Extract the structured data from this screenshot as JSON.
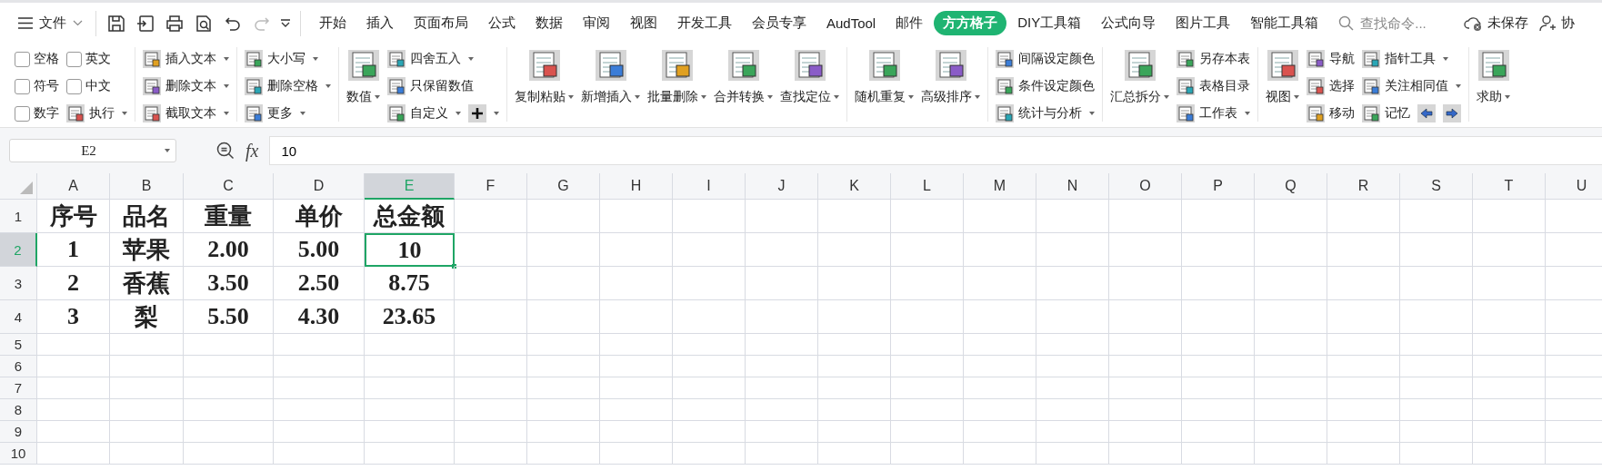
{
  "menu_bar": {
    "file_menu": "文件",
    "quick_access": [
      {
        "disabled": false
      },
      {
        "disabled": false
      },
      {
        "disabled": false
      },
      {
        "disabled": false
      },
      {
        "disabled": false
      },
      {
        "disabled": true
      }
    ],
    "tabs": [
      {
        "label": "开始",
        "selected": false
      },
      {
        "label": "插入",
        "selected": false
      },
      {
        "label": "页面布局",
        "selected": false
      },
      {
        "label": "公式",
        "selected": false
      },
      {
        "label": "数据",
        "selected": false
      },
      {
        "label": "审阅",
        "selected": false
      },
      {
        "label": "视图",
        "selected": false
      },
      {
        "label": "开发工具",
        "selected": false
      },
      {
        "label": "会员专享",
        "selected": false
      },
      {
        "label": "AudTool",
        "selected": false
      },
      {
        "label": "邮件",
        "selected": false
      },
      {
        "label": "方方格子",
        "selected": true
      },
      {
        "label": "DIY工具箱",
        "selected": false
      },
      {
        "label": "公式向导",
        "selected": false
      },
      {
        "label": "图片工具",
        "selected": false
      },
      {
        "label": "智能工具箱",
        "selected": false
      }
    ],
    "search": {
      "placeholder": "查找命令..."
    },
    "save_status": "未保存",
    "collaborate": "协"
  },
  "ribbon": [
    {
      "columns": [
        {
          "kind": "stack",
          "rows": [
            [
              {
                "kind": "checkbox",
                "label": "空格",
                "checked": false
              }
            ],
            [
              {
                "kind": "checkbox",
                "label": "符号",
                "checked": false
              }
            ],
            [
              {
                "kind": "checkbox",
                "label": "数字",
                "checked": false
              }
            ]
          ]
        },
        {
          "kind": "stack",
          "rows": [
            [
              {
                "kind": "checkbox",
                "label": "英文",
                "checked": false
              }
            ],
            [
              {
                "kind": "checkbox",
                "label": "中文",
                "checked": false
              }
            ],
            [
              {
                "kind": "button",
                "label": "执行",
                "dropdown": true
              }
            ]
          ]
        }
      ]
    },
    {
      "columns": [
        {
          "kind": "stack",
          "rows": [
            [
              {
                "kind": "button",
                "label": "插入文本",
                "dropdown": true
              }
            ],
            [
              {
                "kind": "button",
                "label": "删除文本",
                "dropdown": true
              }
            ],
            [
              {
                "kind": "button",
                "label": "截取文本",
                "dropdown": true
              }
            ]
          ]
        }
      ]
    },
    {
      "columns": [
        {
          "kind": "stack",
          "rows": [
            [
              {
                "kind": "button",
                "label": "大小写",
                "dropdown": true
              }
            ],
            [
              {
                "kind": "button",
                "label": "删除空格",
                "dropdown": true
              }
            ],
            [
              {
                "kind": "button",
                "label": "更多",
                "dropdown": true
              }
            ]
          ]
        }
      ]
    },
    {
      "columns": [
        {
          "kind": "large",
          "label": "数值",
          "dropdown": true
        },
        {
          "kind": "stack",
          "rows": [
            [
              {
                "kind": "button",
                "label": "四舍五入",
                "dropdown": true
              }
            ],
            [
              {
                "kind": "button",
                "label": "只保留数值",
                "dropdown": false
              }
            ],
            [
              {
                "kind": "button",
                "label": "自定义",
                "dropdown": true
              },
              {
                "kind": "plus",
                "dropdown": true
              }
            ]
          ]
        }
      ]
    },
    {
      "columns": [
        {
          "kind": "large",
          "label": "复制粘贴",
          "dropdown": true
        },
        {
          "kind": "large",
          "label": "新增插入",
          "dropdown": true
        },
        {
          "kind": "large",
          "label": "批量删除",
          "dropdown": true
        },
        {
          "kind": "large",
          "label": "合并转换",
          "dropdown": true
        },
        {
          "kind": "large",
          "label": "查找定位",
          "dropdown": true
        }
      ]
    },
    {
      "columns": [
        {
          "kind": "large",
          "label": "随机重复",
          "dropdown": true
        },
        {
          "kind": "large",
          "label": "高级排序",
          "dropdown": true
        }
      ]
    },
    {
      "columns": [
        {
          "kind": "stack",
          "rows": [
            [
              {
                "kind": "button",
                "label": "间隔设定颜色",
                "dropdown": false
              }
            ],
            [
              {
                "kind": "button",
                "label": "条件设定颜色",
                "dropdown": false
              }
            ],
            [
              {
                "kind": "button",
                "label": "统计与分析",
                "dropdown": true
              }
            ]
          ]
        }
      ]
    },
    {
      "columns": [
        {
          "kind": "large",
          "label": "汇总拆分",
          "dropdown": true
        },
        {
          "kind": "stack",
          "rows": [
            [
              {
                "kind": "button",
                "label": "另存本表",
                "dropdown": false
              }
            ],
            [
              {
                "kind": "button",
                "label": "表格目录",
                "dropdown": false
              }
            ],
            [
              {
                "kind": "button",
                "label": "工作表",
                "dropdown": true
              }
            ]
          ]
        }
      ]
    },
    {
      "columns": [
        {
          "kind": "large",
          "label": "视图",
          "dropdown": true
        },
        {
          "kind": "stack",
          "rows": [
            [
              {
                "kind": "button",
                "label": "导航",
                "dropdown": false
              }
            ],
            [
              {
                "kind": "button",
                "label": "选择",
                "dropdown": false
              }
            ],
            [
              {
                "kind": "button",
                "label": "移动",
                "dropdown": false
              }
            ]
          ]
        },
        {
          "kind": "stack",
          "rows": [
            [
              {
                "kind": "button",
                "label": "指针工具",
                "dropdown": true
              }
            ],
            [
              {
                "kind": "button",
                "label": "关注相同值",
                "dropdown": true
              }
            ],
            [
              {
                "kind": "button",
                "label": "记忆",
                "dropdown": false
              },
              {
                "kind": "arrow_left"
              },
              {
                "kind": "arrow_right"
              }
            ]
          ]
        }
      ]
    },
    {
      "columns": [
        {
          "kind": "large",
          "label": "求助",
          "dropdown": true
        }
      ]
    }
  ],
  "formula_bar": {
    "name_box": "E2",
    "function_label": "fx",
    "value": "10"
  },
  "sheet": {
    "columns": [
      {
        "label": "A",
        "selected": false
      },
      {
        "label": "B",
        "selected": false
      },
      {
        "label": "C",
        "selected": false
      },
      {
        "label": "D",
        "selected": false
      },
      {
        "label": "E",
        "selected": true
      },
      {
        "label": "F",
        "selected": false
      },
      {
        "label": "G",
        "selected": false
      },
      {
        "label": "H",
        "selected": false
      },
      {
        "label": "I",
        "selected": false
      },
      {
        "label": "J",
        "selected": false
      },
      {
        "label": "K",
        "selected": false
      },
      {
        "label": "L",
        "selected": false
      },
      {
        "label": "M",
        "selected": false
      },
      {
        "label": "N",
        "selected": false
      },
      {
        "label": "O",
        "selected": false
      },
      {
        "label": "P",
        "selected": false
      },
      {
        "label": "Q",
        "selected": false
      },
      {
        "label": "R",
        "selected": false
      },
      {
        "label": "S",
        "selected": false
      },
      {
        "label": "T",
        "selected": false
      },
      {
        "label": "U",
        "selected": false
      }
    ],
    "rows": [
      {
        "number": "1",
        "selected": false,
        "cells": [
          {
            "text": "序号",
            "active": false
          },
          {
            "text": "品名",
            "active": false
          },
          {
            "text": "重量",
            "active": false
          },
          {
            "text": "单价",
            "active": false
          },
          {
            "text": "总金额",
            "active": false
          }
        ]
      },
      {
        "number": "2",
        "selected": true,
        "cells": [
          {
            "text": "1",
            "active": false
          },
          {
            "text": "苹果",
            "active": false
          },
          {
            "text": "2.00",
            "active": false
          },
          {
            "text": "5.00",
            "active": false
          },
          {
            "text": "10",
            "active": true
          }
        ]
      },
      {
        "number": "3",
        "selected": false,
        "cells": [
          {
            "text": "2",
            "active": false
          },
          {
            "text": "香蕉",
            "active": false
          },
          {
            "text": "3.50",
            "active": false
          },
          {
            "text": "2.50",
            "active": false
          },
          {
            "text": "8.75",
            "active": false
          }
        ]
      },
      {
        "number": "4",
        "selected": false,
        "cells": [
          {
            "text": "3",
            "active": false
          },
          {
            "text": "梨",
            "active": false
          },
          {
            "text": "5.50",
            "active": false
          },
          {
            "text": "4.30",
            "active": false
          },
          {
            "text": "23.65",
            "active": false
          }
        ]
      },
      {
        "number": "5",
        "selected": false
      },
      {
        "number": "6",
        "selected": false
      },
      {
        "number": "7",
        "selected": false
      },
      {
        "number": "8",
        "selected": false
      },
      {
        "number": "9",
        "selected": false
      },
      {
        "number": "10",
        "selected": false
      }
    ]
  }
}
